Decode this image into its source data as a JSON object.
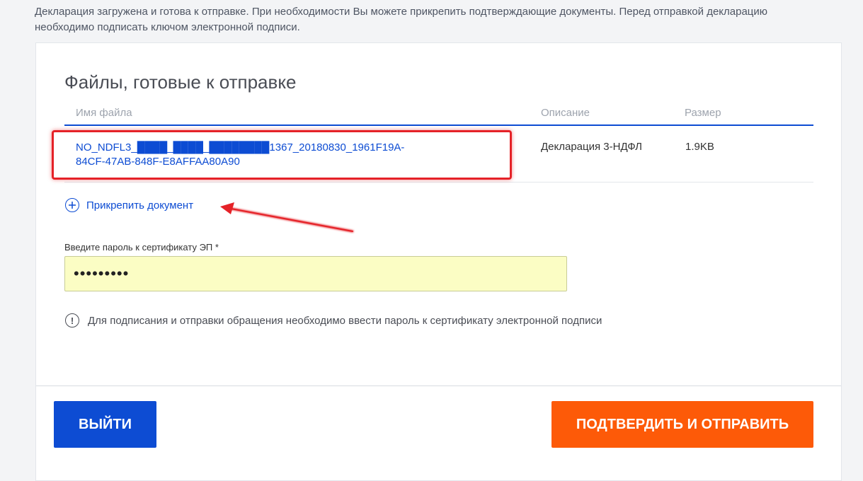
{
  "intro": {
    "text": "Декларация загружена и готова к отправке. При необходимости Вы можете прикрепить подтверждающие документы. Перед отправкой декларацию необходимо подписать ключом электронной подписи."
  },
  "files": {
    "title": "Файлы, готовые к отправке",
    "columns": {
      "name": "Имя файла",
      "description": "Описание",
      "size": "Размер"
    },
    "rows": [
      {
        "name": "NO_NDFL3_████_████_████████1367_20180830_1961F19A-84CF-47AB-848F-E8AFFAA80A90",
        "description": "Декларация 3-НДФЛ",
        "size": "1.9KB"
      }
    ]
  },
  "attach": {
    "label": "Прикрепить документ",
    "icon": "plus-circle-icon"
  },
  "password": {
    "label": "Введите пароль к сертификату ЭП *",
    "value": "•••••••••"
  },
  "info": {
    "text": "Для подписания и отправки обращения необходимо ввести пароль к сертификату электронной подписи",
    "icon": "exclamation-circle-icon"
  },
  "buttons": {
    "exit": "ВЫЙТИ",
    "submit": "ПОДТВЕРДИТЬ И ОТПРАВИТЬ"
  },
  "colors": {
    "accent": "#0d4cd3",
    "submit": "#fd5a08",
    "annotation": "#e52228",
    "input_bg": "#fbfdc4"
  }
}
